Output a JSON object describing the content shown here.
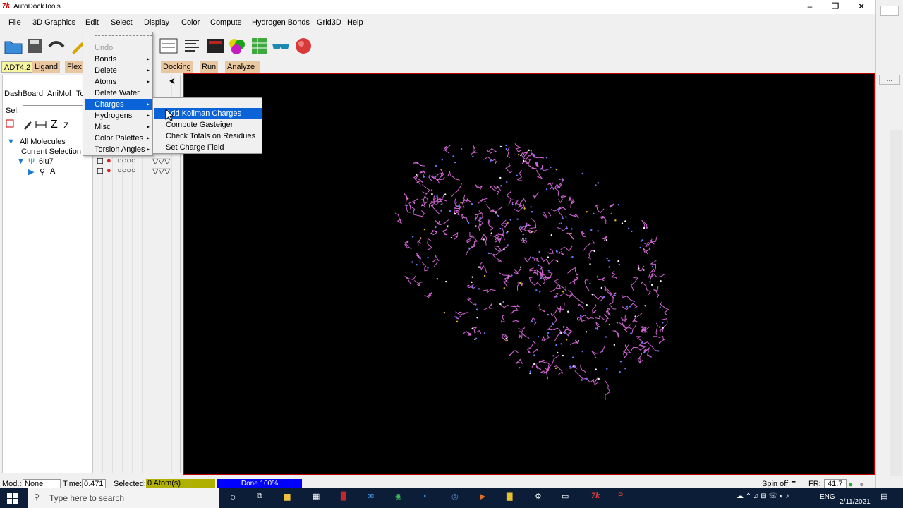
{
  "window": {
    "title": "AutoDockTools"
  },
  "menubar": {
    "items": [
      "File",
      "3D Graphics",
      "Edit",
      "Select",
      "Display",
      "Color",
      "Compute",
      "Hydrogen Bonds",
      "Grid3D",
      "Help"
    ]
  },
  "adt_tabs": [
    "ADT4.2",
    "Ligand",
    "Flex",
    "Docking",
    "Run",
    "Analyze"
  ],
  "left_panel": {
    "tabs": [
      "DashBoard",
      "AniMol",
      "To"
    ],
    "sel_label": "Sel.:",
    "tree": [
      "All Molecules",
      "Current Selection",
      "6lu7",
      "A"
    ],
    "toolbar_glyph": "Z"
  },
  "edit_menu": {
    "items": [
      {
        "label": "Undo",
        "disabled": true,
        "submenu": false
      },
      {
        "label": "Bonds",
        "submenu": true
      },
      {
        "label": "Delete",
        "submenu": true
      },
      {
        "label": "Atoms",
        "submenu": true
      },
      {
        "label": "Delete Water",
        "submenu": false
      },
      {
        "label": "Charges",
        "submenu": true,
        "selected": true
      },
      {
        "label": "Hydrogens",
        "submenu": true
      },
      {
        "label": "Misc",
        "submenu": true
      },
      {
        "label": "Color Palettes",
        "submenu": true
      },
      {
        "label": "Torsion Angles",
        "submenu": true
      }
    ]
  },
  "charges_menu": {
    "items": [
      {
        "label": "Add Kollman Charges",
        "selected": true
      },
      {
        "label": "Compute Gasteiger"
      },
      {
        "label": "Check Totals on Residues"
      },
      {
        "label": "Set Charge Field"
      }
    ]
  },
  "status": {
    "mod_label": "Mod.:",
    "mod_value": "None",
    "time_label": "Time:",
    "time_value": "0.471",
    "selected_label": "Selected:",
    "selected_value": "0 Atom(s)",
    "progress_text": "Done 100%",
    "progress_fraction": 1.0,
    "spin": "Spin off",
    "fr_label": "FR:",
    "fr_value": "41.7"
  },
  "taskbar": {
    "search_placeholder": "Type here to search",
    "lang": "ENG",
    "date": "2/11/2021"
  },
  "colors": {
    "viewer_bg": "#000000",
    "molecule": "#d266d2",
    "menu_highlight": "#0a64d8",
    "selected_bar": "#b0b000",
    "progress": "#0000ff"
  }
}
